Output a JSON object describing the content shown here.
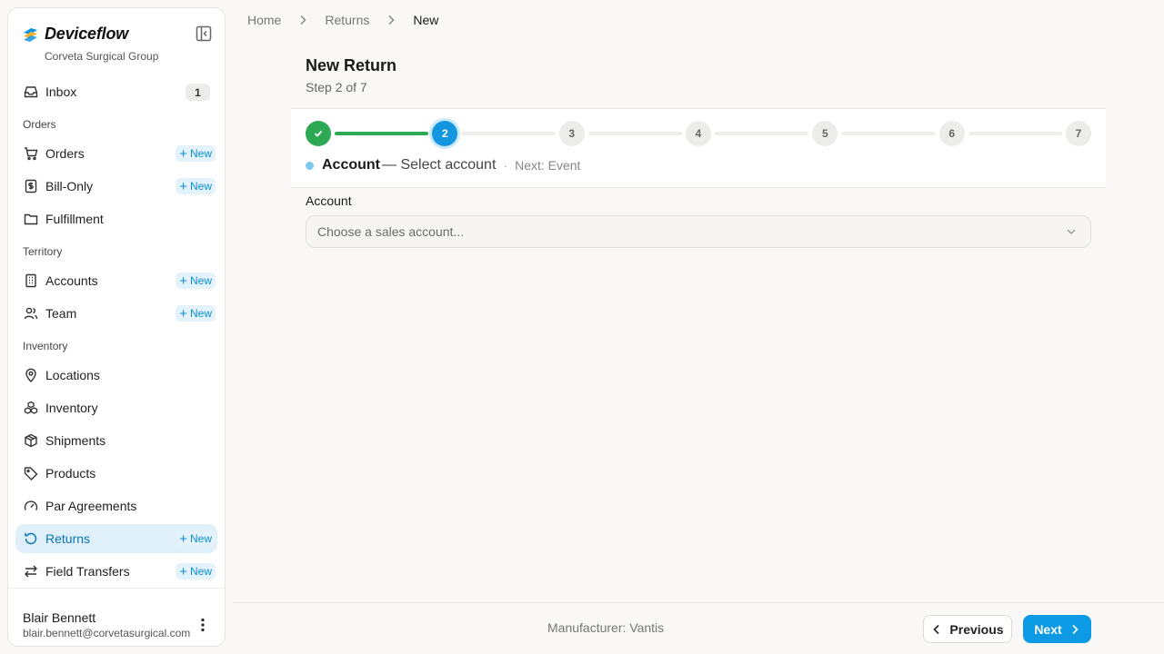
{
  "brand": {
    "name": "Deviceflow",
    "org": "Corveta Surgical Group",
    "accent": "#1396df"
  },
  "sidebar": {
    "inbox": {
      "label": "Inbox",
      "count": "1"
    },
    "sections": {
      "orders": "Orders",
      "territory": "Territory",
      "inventory": "Inventory"
    },
    "new_label": "New",
    "items": {
      "orders": "Orders",
      "bill_only": "Bill-Only",
      "fulfillment": "Fulfillment",
      "accounts": "Accounts",
      "team": "Team",
      "locations": "Locations",
      "inventory": "Inventory",
      "shipments": "Shipments",
      "products": "Products",
      "par_agreements": "Par Agreements",
      "returns": "Returns",
      "field_transfers": "Field Transfers"
    },
    "active_item": "returns"
  },
  "user": {
    "name": "Blair Bennett",
    "email": "blair.bennett@corvetasurgical.com"
  },
  "breadcrumb": {
    "home": "Home",
    "returns": "Returns",
    "current": "New"
  },
  "header": {
    "title": "New Return",
    "subtitle": "Step 2 of 7"
  },
  "stepper": {
    "total_steps": 7,
    "current_step": 2,
    "steps": [
      "1",
      "2",
      "3",
      "4",
      "5",
      "6",
      "7"
    ],
    "current_name": "Account",
    "current_desc": "— Select account",
    "separator": "·",
    "next_label": "Next: Event",
    "colors": {
      "done": "#2eaa55",
      "current": "#1396df",
      "pending": "#ececea"
    }
  },
  "form": {
    "account_label": "Account",
    "account_placeholder": "Choose a sales account..."
  },
  "footer": {
    "manufacturer_label": "Manufacturer:",
    "manufacturer_value": "Vantis",
    "prev_label": "Previous",
    "next_label": "Next"
  }
}
